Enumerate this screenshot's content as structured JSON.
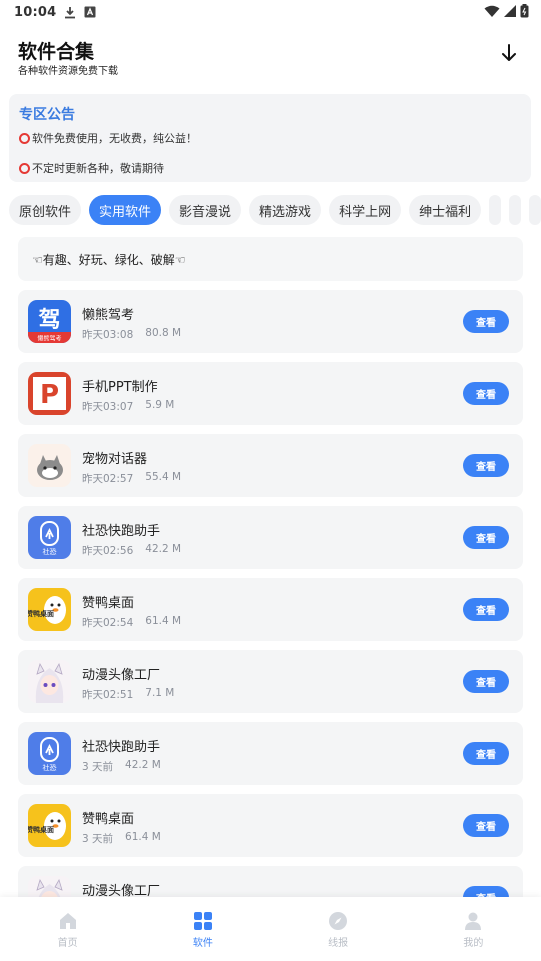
{
  "status_bar": {
    "time": "10:04"
  },
  "header": {
    "title": "软件合集",
    "subtitle": "各种软件资源免费下载"
  },
  "notice": {
    "title": "专区公告",
    "lines": [
      "软件免费使用，无收费，纯公益！",
      "不定时更新各种，敬请期待"
    ]
  },
  "tabs": [
    "原创软件",
    "实用软件",
    "影音漫说",
    "精选游戏",
    "科学上网",
    "绅士福利"
  ],
  "active_tab": "实用软件",
  "tagline": "☜有趣、好玩、绿化、破解☜",
  "items": [
    {
      "name": "懒熊驾考",
      "time": "昨天03:08",
      "size": "80.8 M",
      "action": "查看",
      "icon": "bear-driving-icon",
      "icon_text": "驾",
      "icon_sub": "懒熊驾考"
    },
    {
      "name": "手机PPT制作",
      "time": "昨天03:07",
      "size": "5.9 M",
      "action": "查看",
      "icon": "ppt-icon",
      "icon_text": "P"
    },
    {
      "name": "宠物对话器",
      "time": "昨天02:57",
      "size": "55.4 M",
      "action": "查看",
      "icon": "pet-cat-icon"
    },
    {
      "name": "社恐快跑助手",
      "time": "昨天02:56",
      "size": "42.2 M",
      "action": "查看",
      "icon": "social-run-icon",
      "icon_text": "社恐"
    },
    {
      "name": "赞鸭桌面",
      "time": "昨天02:54",
      "size": "61.4 M",
      "action": "查看",
      "icon": "duck-desktop-icon",
      "icon_text": "赞鸭桌面"
    },
    {
      "name": "动漫头像工厂",
      "time": "昨天02:51",
      "size": "7.1 M",
      "action": "查看",
      "icon": "anime-avatar-icon"
    },
    {
      "name": "社恐快跑助手",
      "time": "3 天前",
      "size": "42.2 M",
      "action": "查看",
      "icon": "social-run-icon",
      "icon_text": "社恐"
    },
    {
      "name": "赞鸭桌面",
      "time": "3 天前",
      "size": "61.4 M",
      "action": "查看",
      "icon": "duck-desktop-icon",
      "icon_text": "赞鸭桌面"
    },
    {
      "name": "动漫头像工厂",
      "time": "",
      "size": "",
      "action": "查看",
      "icon": "anime-avatar-icon"
    }
  ],
  "nav": [
    {
      "label": "首页",
      "icon": "home-icon",
      "active": false
    },
    {
      "label": "软件",
      "icon": "grid-icon",
      "active": true
    },
    {
      "label": "线报",
      "icon": "compass-icon",
      "active": false
    },
    {
      "label": "我的",
      "icon": "user-icon",
      "active": false
    }
  ],
  "colors": {
    "accent": "#3b82f6",
    "notice_title": "#3a7be0",
    "inactive_nav": "#b9bec6"
  }
}
